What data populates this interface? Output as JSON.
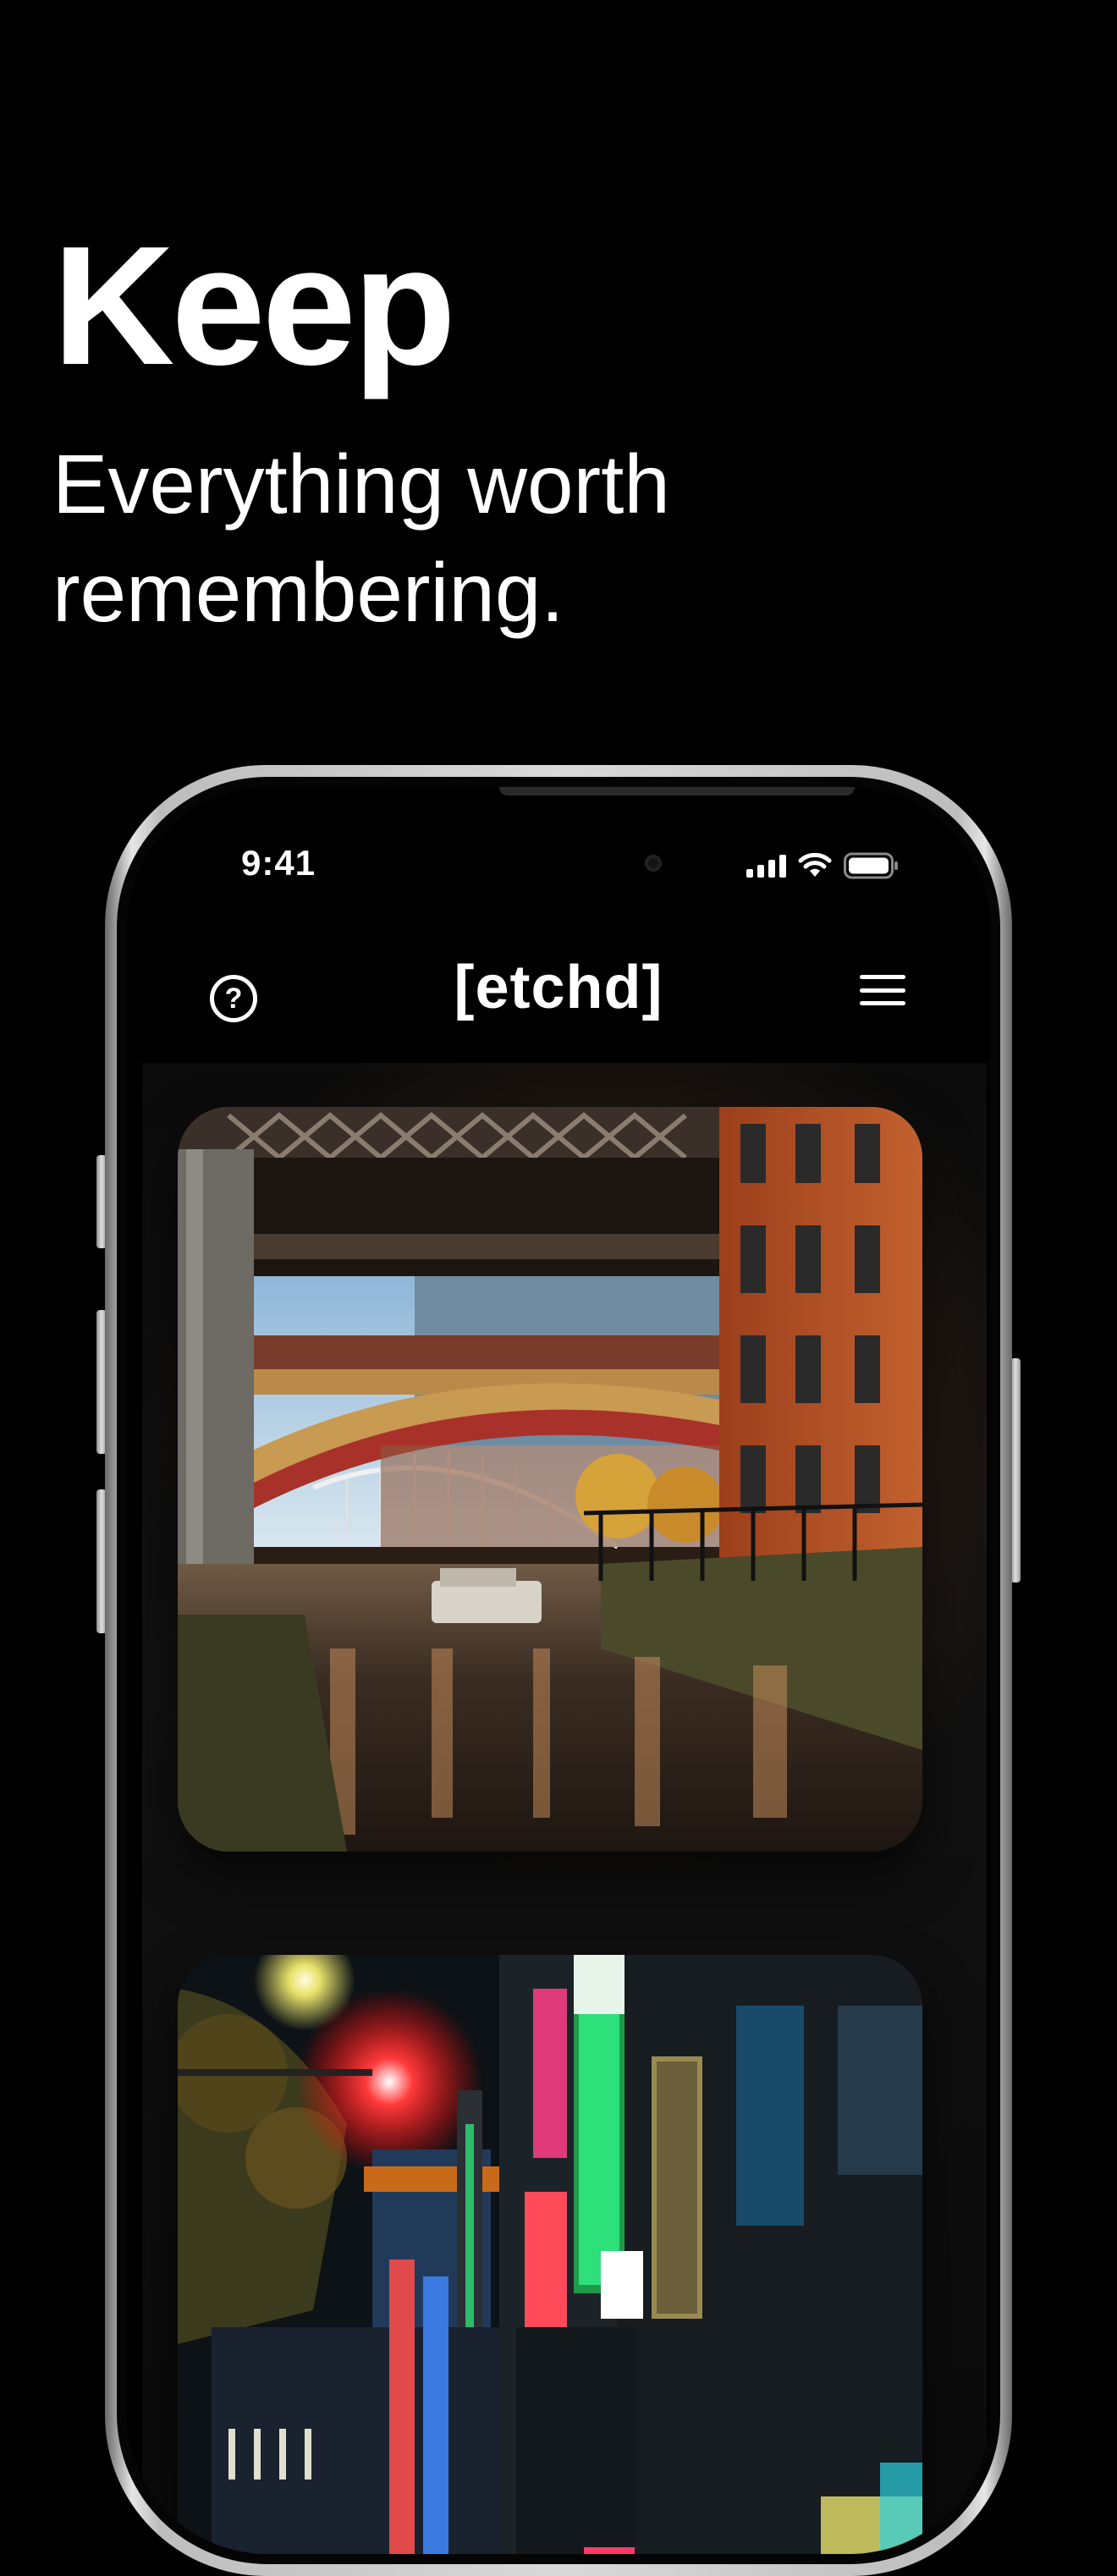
{
  "promo": {
    "headline": "Keep",
    "subheadline": "Everything worth remembering."
  },
  "status_bar": {
    "time": "9:41",
    "icons": [
      "signal-icon",
      "wifi-icon",
      "battery-icon"
    ]
  },
  "app": {
    "title": "[etchd]",
    "help_icon": "question-circle-icon",
    "menu_icon": "hamburger-menu-icon"
  },
  "feed": {
    "photos": [
      {
        "subject": "canal-bridge-photo"
      },
      {
        "subject": "neon-street-photo"
      }
    ]
  },
  "colors": {
    "background": "#000000",
    "text": "#ffffff",
    "brick": "#b5522a",
    "neon_green": "#2de07a",
    "neon_red": "#ff2a2a"
  }
}
